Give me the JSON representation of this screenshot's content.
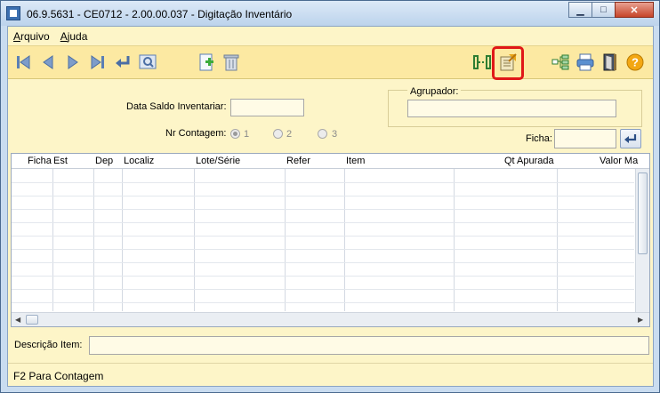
{
  "window": {
    "title": "06.9.5631 - CE0712 - 2.00.00.037 - Digitação Inventário",
    "buttons": [
      "minimize",
      "maximize",
      "close"
    ]
  },
  "menu": [
    {
      "label": "Arquivo"
    },
    {
      "label": "Ajuda"
    }
  ],
  "toolbar": {
    "icons": [
      "first-record-icon",
      "previous-record-icon",
      "next-record-icon",
      "last-record-icon",
      "return-icon",
      "zoom-icon",
      "new-record-icon",
      "delete-icon",
      "link-icon",
      "edit-document-icon",
      "tree-icon",
      "print-icon",
      "exit-icon",
      "help-icon"
    ],
    "highlighted": "edit-document-icon"
  },
  "form": {
    "data_saldo_label": "Data Saldo Inventariar:",
    "data_saldo_value": "",
    "agrupador_label": "Agrupador:",
    "agrupador_value": "",
    "nr_contagem_label": "Nr Contagem:",
    "contagem_options": [
      "1",
      "2",
      "3"
    ],
    "contagem_selected": "1",
    "ficha_label": "Ficha:",
    "ficha_value": ""
  },
  "grid": {
    "columns": [
      "Ficha",
      "Est",
      "Dep",
      "Localiz",
      "Lote/Série",
      "Refer",
      "Item",
      "Qt Apurada",
      "Valor Ma"
    ],
    "rows": []
  },
  "descricao": {
    "label": "Descrição Item:",
    "value": ""
  },
  "status": {
    "text": "F2 Para Contagem"
  }
}
